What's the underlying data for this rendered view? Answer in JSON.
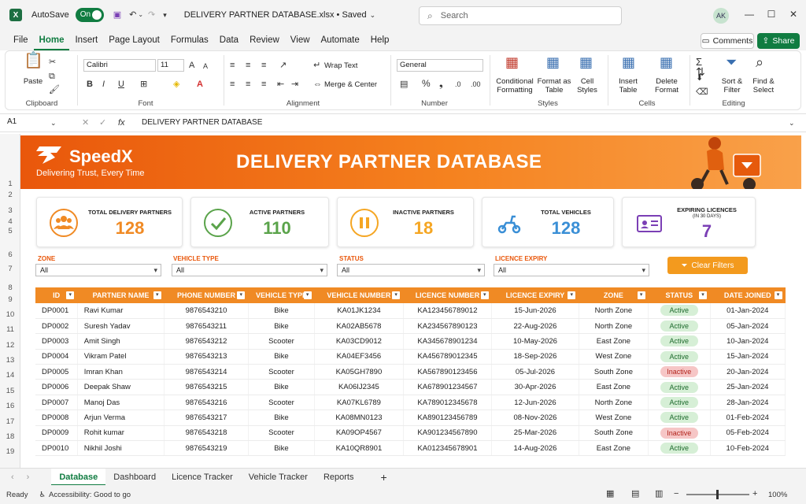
{
  "titlebar": {
    "autosave_label": "AutoSave",
    "autosave_state": "On",
    "filename": "DELIVERY PARTNER DATABASE.xlsx • Saved",
    "search_placeholder": "Search",
    "user_initials": "AK"
  },
  "menu": [
    "File",
    "Home",
    "Insert",
    "Page Layout",
    "Formulas",
    "Data",
    "Review",
    "View",
    "Automate",
    "Help"
  ],
  "menu_active": "Home",
  "comments_label": "Comments",
  "share_label": "Share",
  "ribbon": {
    "clipboard": {
      "paste": "Paste",
      "label": "Clipboard"
    },
    "font": {
      "name": "Calibri",
      "size": "11",
      "label": "Font"
    },
    "alignment": {
      "wrap": "Wrap Text",
      "merge": "Merge & Center",
      "label": "Alignment"
    },
    "number": {
      "format": "General",
      "label": "Number"
    },
    "styles": {
      "conditional_1": "Conditional",
      "conditional_2": "Formatting",
      "format_table_1": "Format as",
      "format_table_2": "Table",
      "cell_styles_1": "Cell",
      "cell_styles_2": "Styles",
      "label": "Styles"
    },
    "cells": {
      "insert_1": "Insert",
      "insert_2": "Table",
      "delete_1": "Delete",
      "delete_2": "Format",
      "label": "Cells"
    },
    "editing": {
      "sort_1": "Sort &",
      "sort_2": "Filter",
      "find_1": "Find &",
      "find_2": "Select",
      "label": "Editing"
    }
  },
  "formula_bar": {
    "cell_ref": "A1",
    "fx": "fx",
    "content": "DELIVERY PARTNER DATABASE"
  },
  "row_numbers": [
    "1",
    "2",
    "3",
    "4",
    "5",
    "6",
    "7",
    "8",
    "9",
    "10",
    "11",
    "12",
    "13",
    "14",
    "15",
    "16",
    "17",
    "18",
    "19"
  ],
  "banner": {
    "brand": "SpeedX",
    "tagline": "Delivering Trust, Every Time",
    "title": "DELIVERY PARTNER DATABASE"
  },
  "cards": [
    {
      "label": "TOTAL DELIVERY PARTNERS",
      "sublabel": "",
      "value": "128",
      "color": "#f08a24",
      "icon": "people-icon"
    },
    {
      "label": "ACTIVE PARTNERS",
      "sublabel": "",
      "value": "110",
      "color": "#5aa34a",
      "icon": "check-icon"
    },
    {
      "label": "INACTIVE PARTNERS",
      "sublabel": "",
      "value": "18",
      "color": "#f5a623",
      "icon": "pause-icon"
    },
    {
      "label": "TOTAL VEHICLES",
      "sublabel": "",
      "value": "128",
      "color": "#3a8fd6",
      "icon": "scooter-icon"
    },
    {
      "label": "EXPIRING LICENCES",
      "sublabel": "(IN 30 DAYS)",
      "value": "7",
      "color": "#7b3fb5",
      "icon": "id-card-icon"
    }
  ],
  "filters": [
    {
      "label": "ZONE",
      "value": "All"
    },
    {
      "label": "VEHICLE TYPE",
      "value": "All"
    },
    {
      "label": "STATUS",
      "value": "All"
    },
    {
      "label": "LICENCE EXPIRY",
      "value": "All"
    }
  ],
  "clear_filters": "Clear Filters",
  "table": {
    "headers": [
      "ID",
      "PARTNER NAME",
      "PHONE NUMBER",
      "VEHICLE TYPE",
      "VEHICLE NUMBER",
      "LICENCE NUMBER",
      "LICENCE EXPIRY",
      "ZONE",
      "STATUS",
      "DATE JOINED"
    ],
    "rows": [
      [
        "DP0001",
        "Ravi Kumar",
        "9876543210",
        "Bike",
        "KA01JK1234",
        "KA123456789012",
        "15-Jun-2026",
        "North Zone",
        "Active",
        "01-Jan-2024"
      ],
      [
        "DP0002",
        "Suresh Yadav",
        "9876543211",
        "Bike",
        "KA02AB5678",
        "KA234567890123",
        "22-Aug-2026",
        "North Zone",
        "Active",
        "05-Jan-2024"
      ],
      [
        "DP0003",
        "Amit Singh",
        "9876543212",
        "Scooter",
        "KA03CD9012",
        "KA345678901234",
        "10-May-2026",
        "East Zone",
        "Active",
        "10-Jan-2024"
      ],
      [
        "DP0004",
        "Vikram Patel",
        "9876543213",
        "Bike",
        "KA04EF3456",
        "KA456789012345",
        "18-Sep-2026",
        "West Zone",
        "Active",
        "15-Jan-2024"
      ],
      [
        "DP0005",
        "Imran Khan",
        "9876543214",
        "Scooter",
        "KA05GH7890",
        "KA567890123456",
        "05-Jul-2026",
        "South Zone",
        "Inactive",
        "20-Jan-2024"
      ],
      [
        "DP0006",
        "Deepak Shaw",
        "9876543215",
        "Bike",
        "KA06IJ2345",
        "KA678901234567",
        "30-Apr-2026",
        "East Zone",
        "Active",
        "25-Jan-2024"
      ],
      [
        "DP0007",
        "Manoj Das",
        "9876543216",
        "Scooter",
        "KA07KL6789",
        "KA789012345678",
        "12-Jun-2026",
        "North Zone",
        "Active",
        "28-Jan-2024"
      ],
      [
        "DP0008",
        "Arjun Verma",
        "9876543217",
        "Bike",
        "KA08MN0123",
        "KA890123456789",
        "08-Nov-2026",
        "West Zone",
        "Active",
        "01-Feb-2024"
      ],
      [
        "DP0009",
        "Rohit kumar",
        "9876543218",
        "Scooter",
        "KA09OP4567",
        "KA901234567890",
        "25-Mar-2026",
        "South Zone",
        "Inactive",
        "05-Feb-2024"
      ],
      [
        "DP0010",
        "Nikhil Joshi",
        "9876543219",
        "Bike",
        "KA10QR8901",
        "KA012345678901",
        "14-Aug-2026",
        "East Zone",
        "Active",
        "10-Feb-2024"
      ]
    ]
  },
  "sheet_tabs": [
    "Database",
    "Dashboard",
    "Licence Tracker",
    "Vehicle Tracker",
    "Reports"
  ],
  "sheet_active": "Database",
  "statusbar": {
    "ready": "Ready",
    "accessibility": "Accessibility: Good to go",
    "zoom": "100%"
  }
}
